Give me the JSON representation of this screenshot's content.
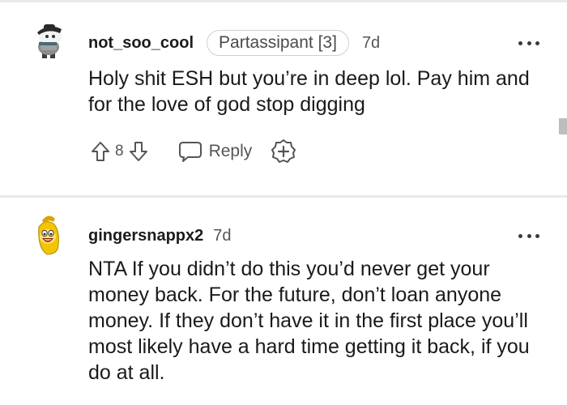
{
  "comments": [
    {
      "username": "not_soo_cool",
      "flair": "Partassipant [3]",
      "age": "7d",
      "body": "Holy shit ESH but you’re in deep lol. Pay him and for the love of god stop digging",
      "score": "8",
      "reply_label": "Reply",
      "avatar_icon": "snoo-avatar-dark-icon"
    },
    {
      "username": "gingersnappx2",
      "age": "7d",
      "body": "NTA If you didn’t do this you’d never get your money back. For the future, don’t loan anyone money. If they don’t have it in the first place you’ll most likely have a hard time getting it back, if you do at all.",
      "avatar_icon": "snoo-avatar-yellow-icon"
    }
  ],
  "colors": {
    "text": "#1c1c1c",
    "meta": "#555555",
    "divider": "#eaeaea",
    "flair_border": "#cfcfcf"
  }
}
